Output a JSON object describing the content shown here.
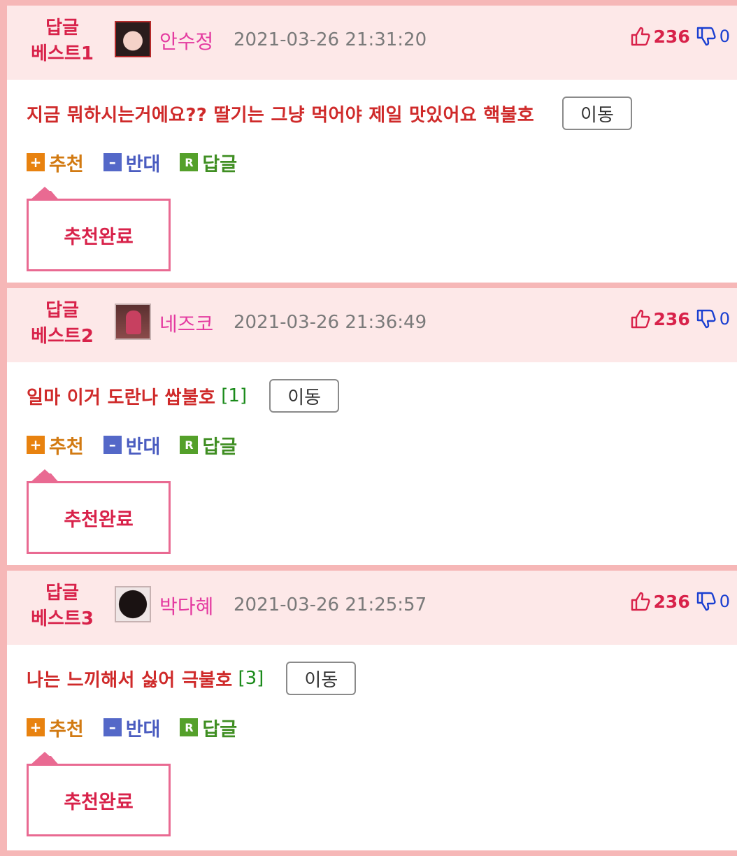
{
  "colors": {
    "accent_red": "#d8224a",
    "author_pink": "#e43aa0",
    "recommend_orange": "#d27a12",
    "oppose_blue": "#4a5cc0",
    "reply_green": "#3f8e22",
    "header_bg": "#fde8e8",
    "frame_bg": "#f6b7b7"
  },
  "actions": {
    "recommend_icon": "+",
    "recommend_label": "추천",
    "oppose_icon": "–",
    "oppose_label": "반대",
    "reply_icon": "R",
    "reply_label": "답글"
  },
  "move_label": "이동",
  "recommend_done": "추천완료",
  "comments": [
    {
      "badge_line1": "답글",
      "badge_line2": "베스트1",
      "author": "안수정",
      "date": "2021-03-26 21:31:20",
      "upvotes": "236",
      "downvotes": "0",
      "content": "지금 뭐하시는거에요?? 딸기는 그냥 먹어야 제일 맛있어요 핵불호",
      "reply_count": ""
    },
    {
      "badge_line1": "답글",
      "badge_line2": "베스트2",
      "author": "네즈코",
      "date": "2021-03-26 21:36:49",
      "upvotes": "236",
      "downvotes": "0",
      "content": "일마 이거 도란나 쌉불호",
      "reply_count": "[1]"
    },
    {
      "badge_line1": "답글",
      "badge_line2": "베스트3",
      "author": "박다혜",
      "date": "2021-03-26 21:25:57",
      "upvotes": "236",
      "downvotes": "0",
      "content": "나는 느끼해서 싫어 극불호",
      "reply_count": "[3]"
    }
  ]
}
